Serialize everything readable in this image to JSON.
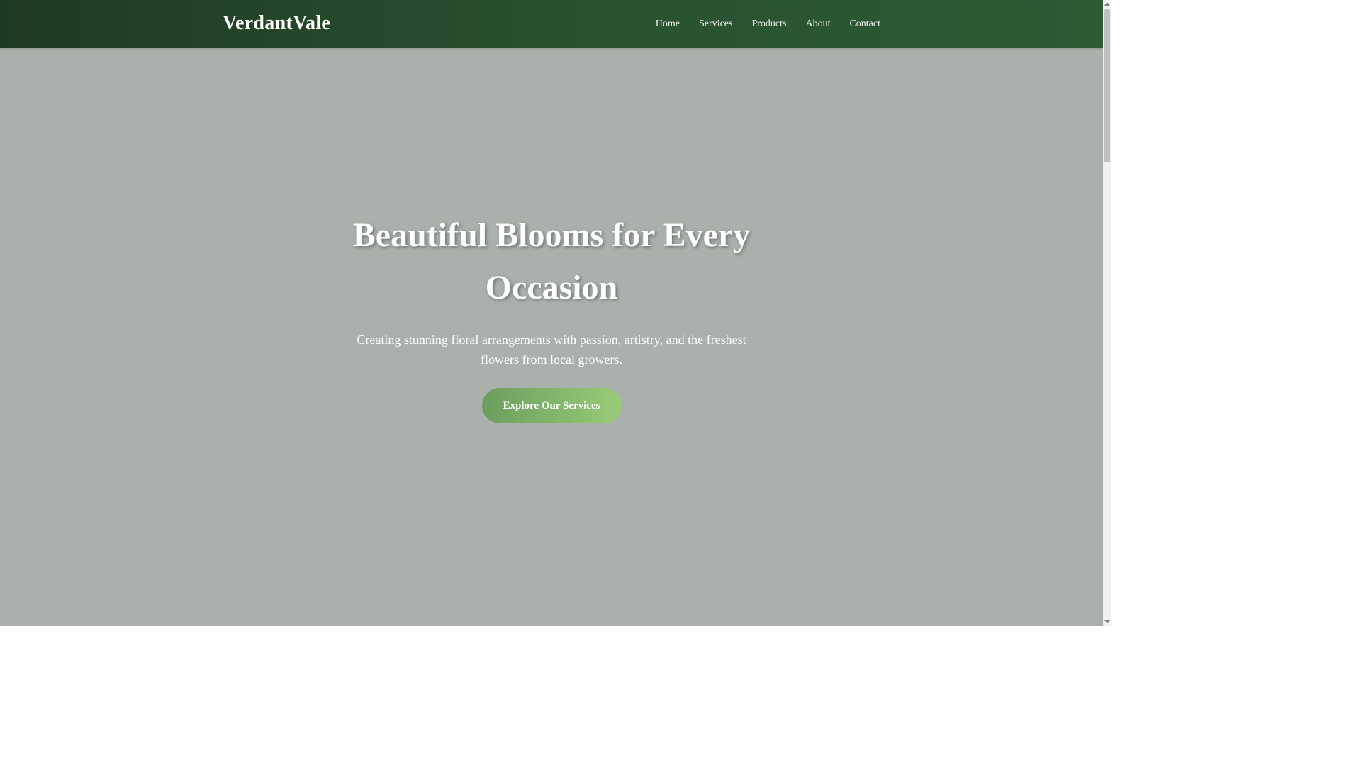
{
  "brand": {
    "name": "VerdantVale"
  },
  "nav": {
    "items": [
      {
        "label": "Home"
      },
      {
        "label": "Services"
      },
      {
        "label": "Products"
      },
      {
        "label": "About"
      },
      {
        "label": "Contact"
      }
    ]
  },
  "hero": {
    "title": "Beautiful Blooms for Every Occasion",
    "subtitle": "Creating stunning floral arrangements with passion, artistry, and the freshest flowers from local growers.",
    "cta_label": "Explore Our Services"
  },
  "colors": {
    "nav_background_start": "#1f3a22",
    "nav_background_end": "#2c5a33",
    "hero_background": "#aab0ab",
    "cta_gradient_start": "#6b9e5e",
    "cta_gradient_end": "#99cb78",
    "text_light": "#ffffff"
  },
  "scrollbar": {
    "icons": [
      "scroll-up-arrow-icon",
      "scroll-down-arrow-icon"
    ]
  }
}
